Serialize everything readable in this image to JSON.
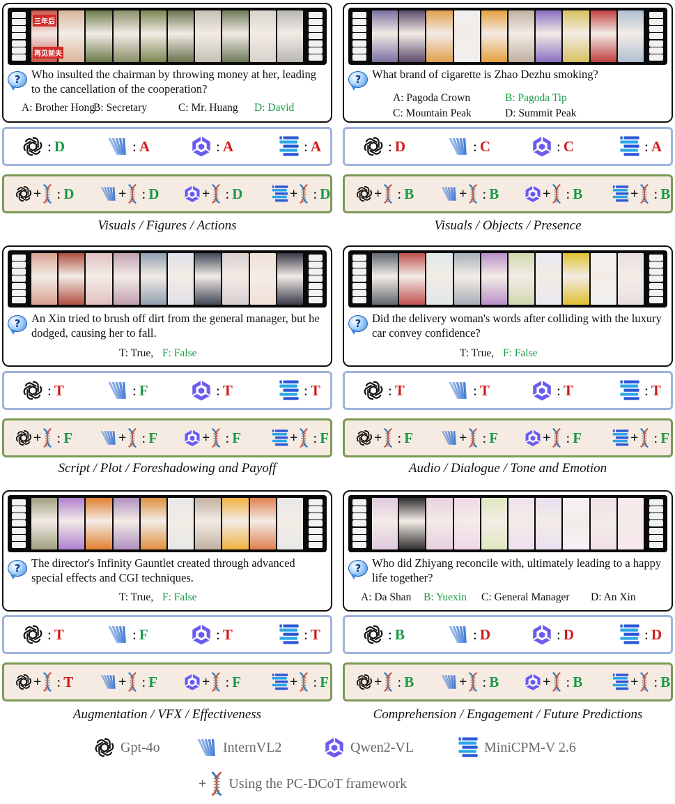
{
  "panels": [
    {
      "question": "Who insulted the chairman by throwing money at her, leading to the cancellation of the cooperation?",
      "options": [
        {
          "text": "A: Brother Hong",
          "correct": false
        },
        {
          "text": "B: Secretary",
          "correct": false
        },
        {
          "text": "C: Mr. Huang",
          "correct": false
        },
        {
          "text": "D: David",
          "correct": true
        }
      ],
      "frame_text": [
        "三年后",
        "再见前夫"
      ],
      "baseline": [
        "D",
        "A",
        "A",
        "A"
      ],
      "baseline_ok": [
        true,
        false,
        false,
        false
      ],
      "pcdcot": [
        "D",
        "D",
        "D",
        "D"
      ],
      "pcdcot_ok": [
        true,
        true,
        true,
        true
      ],
      "caption": "Visuals / Figures / Actions"
    },
    {
      "question": "What brand of cigarette is Zhao Dezhu smoking?",
      "options": [
        {
          "text": "A: Pagoda Crown",
          "correct": false
        },
        {
          "text": "B: Pagoda Tip",
          "correct": true
        },
        {
          "text": "C: Mountain Peak",
          "correct": false
        },
        {
          "text": "D: Summit Peak",
          "correct": false
        }
      ],
      "baseline": [
        "D",
        "C",
        "C",
        "A"
      ],
      "baseline_ok": [
        false,
        false,
        false,
        false
      ],
      "pcdcot": [
        "B",
        "B",
        "B",
        "B"
      ],
      "pcdcot_ok": [
        true,
        true,
        true,
        true
      ],
      "caption": "Visuals / Objects / Presence"
    },
    {
      "question": "An Xin tried to brush off dirt from the general manager, but he dodged, causing her to fall.",
      "options": [
        {
          "text": "T: True,",
          "correct": false
        },
        {
          "text": "F: False",
          "correct": true
        }
      ],
      "baseline": [
        "T",
        "F",
        "T",
        "T"
      ],
      "baseline_ok": [
        false,
        true,
        false,
        false
      ],
      "pcdcot": [
        "F",
        "F",
        "F",
        "F"
      ],
      "pcdcot_ok": [
        true,
        true,
        true,
        true
      ],
      "caption": "Script / Plot / Foreshadowing and Payoff"
    },
    {
      "question": "Did the delivery woman's words after colliding with the luxury car convey confidence?",
      "options": [
        {
          "text": "T: True,",
          "correct": false
        },
        {
          "text": "F: False",
          "correct": true
        }
      ],
      "baseline": [
        "T",
        "T",
        "T",
        "T"
      ],
      "baseline_ok": [
        false,
        false,
        false,
        false
      ],
      "pcdcot": [
        "F",
        "F",
        "F",
        "F"
      ],
      "pcdcot_ok": [
        true,
        true,
        true,
        true
      ],
      "caption": "Audio / Dialogue / Tone and Emotion"
    },
    {
      "question": "The director's Infinity Gauntlet created through advanced special effects and CGI techniques.",
      "options": [
        {
          "text": "T: True,",
          "correct": false
        },
        {
          "text": "F: False",
          "correct": true
        }
      ],
      "baseline": [
        "T",
        "F",
        "T",
        "T"
      ],
      "baseline_ok": [
        false,
        true,
        false,
        false
      ],
      "pcdcot": [
        "T",
        "F",
        "F",
        "F"
      ],
      "pcdcot_ok": [
        false,
        true,
        true,
        true
      ],
      "caption": "Augmentation / VFX / Effectiveness"
    },
    {
      "question": "Who did Zhiyang reconcile with, ultimately leading to a happy life together?",
      "options": [
        {
          "text": "A: Da Shan",
          "correct": false
        },
        {
          "text": "B: Yuexin",
          "correct": true
        },
        {
          "text": "C: General Manager",
          "correct": false
        },
        {
          "text": "D: An Xin",
          "correct": false
        }
      ],
      "baseline": [
        "B",
        "D",
        "D",
        "D"
      ],
      "baseline_ok": [
        true,
        false,
        false,
        false
      ],
      "pcdcot": [
        "B",
        "B",
        "B",
        "B"
      ],
      "pcdcot_ok": [
        true,
        true,
        true,
        true
      ],
      "caption": "Comprehension / Engagement / Future Predictions"
    }
  ],
  "legend": {
    "models": [
      "Gpt-4o",
      "InternVL2",
      "Qwen2-VL",
      "MiniCPM-V 2.6"
    ],
    "framework": "Using the PC-DCoT framework"
  },
  "question_icon": "?",
  "colors": {
    "correct": "#1a9a46",
    "wrong": "#d11a1a",
    "baseline_border": "#9fb4dc",
    "framework_border": "#7a9a56",
    "framework_bg": "#f6ebe3"
  }
}
